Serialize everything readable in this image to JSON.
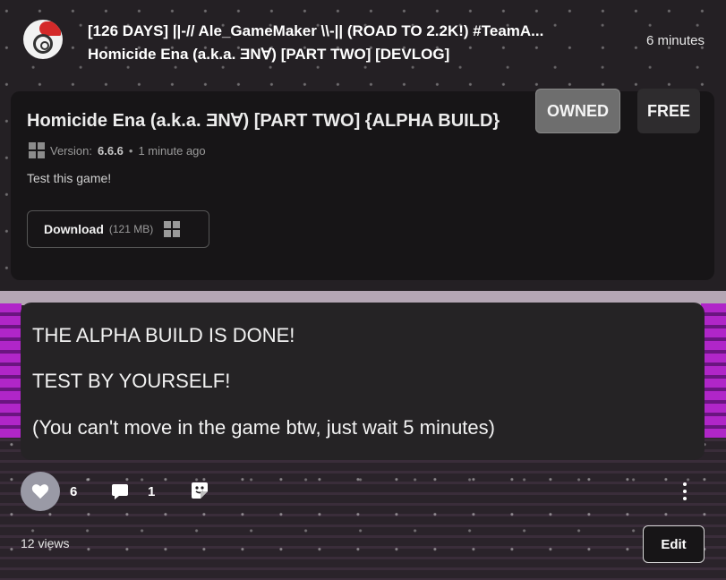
{
  "header": {
    "title_line1": "[126 DAYS] ||-// Ale_GameMaker \\\\-|| (ROAD TO 2.2K!) #TeamA...",
    "title_line2": "Homicide Ena (a.k.a. ƎNⱯ) [PART TWO] [DEVLOG]",
    "time": "6 minutes"
  },
  "game_card": {
    "name": "Homicide Ena (a.k.a. ƎNⱯ) [PART TWO] {ALPHA BUILD}",
    "version_label": "Version:",
    "version": "6.6.6",
    "separator": "•",
    "updated": "1 minute ago",
    "description": "Test this game!",
    "download_label": "Download",
    "download_size": "(121 MB)",
    "platform_icon": "windows-icon"
  },
  "badges": {
    "owned": "OWNED",
    "free": "FREE"
  },
  "post": {
    "paragraphs": [
      "THE ALPHA BUILD IS DONE!",
      "TEST BY YOURSELF!",
      "(You can't move in the game btw, just wait 5 minutes)"
    ]
  },
  "actions": {
    "likes": "6",
    "comments": "1",
    "views": "12 views",
    "edit_label": "Edit"
  }
}
